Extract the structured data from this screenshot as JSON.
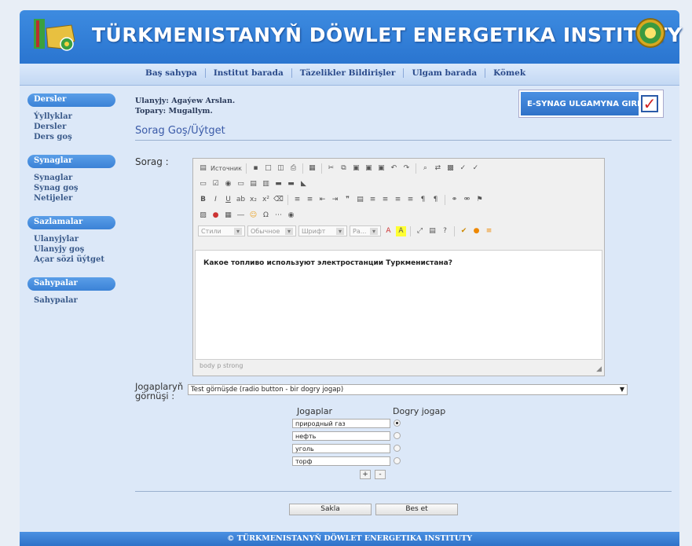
{
  "header": {
    "title": "TÜRKMENISTANYŇ DÖWLET ENERGETIKA INSTITUTY",
    "logo_icon": "flag-map-logo",
    "emblem_icon": "state-emblem"
  },
  "nav": [
    "Baş sahypa",
    "Institut barada",
    "Täzelikler Bildirişler",
    "Ulgam barada",
    "Kömek"
  ],
  "sidebar": {
    "sections": [
      {
        "title": "Dersler",
        "items": [
          "Ýyllyklar",
          "Dersler",
          "Ders goş"
        ]
      },
      {
        "title": "Synaglar",
        "items": [
          "Synaglar",
          "Synag goş",
          "Netijeler"
        ]
      },
      {
        "title": "Sazlamalar",
        "items": [
          "Ulanyjylar",
          "Ulanyjy goş",
          "Açar sözi üýtget"
        ]
      },
      {
        "title": "Sahypalar",
        "items": [
          "Sahypalar"
        ]
      }
    ]
  },
  "user": {
    "name_line": "Ulanyjy: Agaýew Arslan.",
    "group_line": "Topary: Mugallym."
  },
  "esynag_button": "E-SYNAG ULGAMYNA GIRIŞ",
  "page_heading": "Sorag Goş/Üýtget",
  "sorag_label": "Sorag :",
  "editor": {
    "source_label": "Источник",
    "style_combo": "Стили",
    "format_combo": "Обычное",
    "font_combo": "Шрифт",
    "size_combo": "Ра...",
    "content": "Какое топливо используют электростанции Туркменистана?",
    "status": "body  p  strong"
  },
  "answer_type": {
    "label_line1": "Jogaplaryň",
    "label_line2": "görnüşi :",
    "selected": "Test görnüşde (radio button - bir dogry jogap)"
  },
  "answers": {
    "col_answers": "Jogaplar",
    "col_correct": "Dogry jogap",
    "items": [
      "природный газ",
      "нефть",
      "уголь",
      "торф"
    ],
    "correct_index": 0,
    "add_label": "+",
    "remove_label": "-"
  },
  "buttons": {
    "save": "Sakla",
    "cancel": "Bes et"
  },
  "footer": "© TÜRKMENISTANYŇ DÖWLET ENERGETIKA INSTITUTY"
}
